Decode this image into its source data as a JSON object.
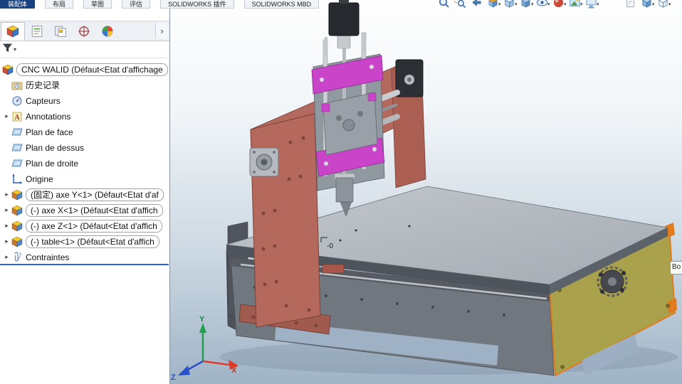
{
  "command_bar": {
    "tabs": [
      {
        "label": "装配体",
        "active": true
      },
      {
        "label": "布局",
        "active": false
      },
      {
        "label": "草图",
        "active": false
      },
      {
        "label": "评估",
        "active": false
      },
      {
        "label": "SOLIDWORKS 插件",
        "active": false
      },
      {
        "label": "SOLIDWORKS MBD",
        "active": false
      }
    ]
  },
  "heads_up_toolbar": {
    "groups": [
      {
        "icons": [
          {
            "name": "zoom-fit-icon",
            "caret": false
          },
          {
            "name": "zoom-area-icon",
            "caret": false
          },
          {
            "name": "previous-view-icon",
            "caret": false
          },
          {
            "name": "section-view-icon",
            "caret": true
          },
          {
            "name": "view-orientation-icon",
            "caret": true
          },
          {
            "name": "display-style-icon",
            "caret": true
          },
          {
            "name": "hide-show-items-icon",
            "caret": true
          },
          {
            "name": "edit-appearance-icon",
            "caret": true
          },
          {
            "name": "apply-scene-icon",
            "caret": true
          },
          {
            "name": "view-settings-icon",
            "caret": true
          }
        ]
      },
      {
        "icons": [
          {
            "name": "sheet-icon",
            "caret": false
          },
          {
            "name": "cube-blue-icon",
            "caret": true
          },
          {
            "name": "cube-outline-icon",
            "caret": true
          }
        ]
      }
    ]
  },
  "feature_panel": {
    "flyout_arrow": "›",
    "tabs": [
      {
        "name": "feature-manager-tab",
        "active": true
      },
      {
        "name": "property-manager-tab",
        "active": false
      },
      {
        "name": "configuration-manager-tab",
        "active": false
      },
      {
        "name": "dimxpert-manager-tab",
        "active": false
      },
      {
        "name": "display-manager-tab",
        "active": false
      }
    ],
    "tree": [
      {
        "icon": "assembly-icon",
        "label": "CNC WALID  (Défaut<Etat d'affichage",
        "arrow": false,
        "boxed": true,
        "root": true
      },
      {
        "icon": "history-icon",
        "label": "历史记录",
        "arrow": false,
        "boxed": false
      },
      {
        "icon": "sensors-icon",
        "label": "Capteurs",
        "arrow": false,
        "boxed": false
      },
      {
        "icon": "annotations-icon",
        "label": "Annotations",
        "arrow": true,
        "boxed": false
      },
      {
        "icon": "plane-icon",
        "label": "Plan de face",
        "arrow": false,
        "boxed": false
      },
      {
        "icon": "plane-icon",
        "label": "Plan de dessus",
        "arrow": false,
        "boxed": false
      },
      {
        "icon": "plane-icon",
        "label": "Plan de droite",
        "arrow": false,
        "boxed": false
      },
      {
        "icon": "origin-icon",
        "label": "Origine",
        "arrow": false,
        "boxed": false
      },
      {
        "icon": "component-icon",
        "label": "(固定) axe Y<1> (Défaut<Etat d'af",
        "arrow": true,
        "boxed": true
      },
      {
        "icon": "component-icon",
        "label": "(-) axe X<1> (Défaut<Etat d'affich",
        "arrow": true,
        "boxed": true
      },
      {
        "icon": "component-icon",
        "label": "(-) axe Z<1> (Défaut<Etat d'affich",
        "arrow": true,
        "boxed": true
      },
      {
        "icon": "component-icon",
        "label": "(-) table<1> (Défaut<Etat d'affich",
        "arrow": true,
        "boxed": true
      },
      {
        "icon": "mates-icon",
        "label": "Contraintes",
        "arrow": true,
        "boxed": false
      }
    ]
  },
  "viewport": {
    "triad": {
      "x_label": "X",
      "y_label": "Y",
      "z_label": "Z"
    },
    "origin_annotation": "-0",
    "side_tooltip": "Bo"
  },
  "colors": {
    "accent_blue": "#2562d8",
    "frame_salmon": "#b4695e",
    "panel_olive": "#a9a14b",
    "olive_edge": "#e07c1e",
    "magenta": "#c944c9"
  }
}
